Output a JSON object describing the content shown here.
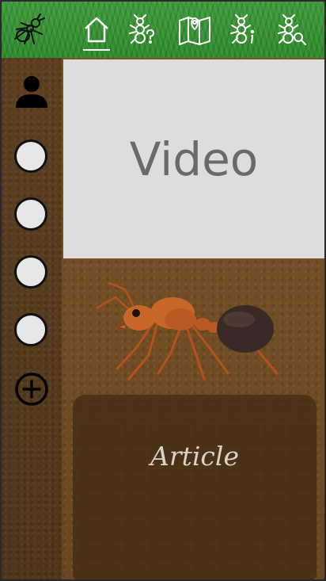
{
  "nav": {
    "items": [
      {
        "icon": "ant-logo-icon"
      },
      {
        "icon": "home-icon",
        "active": true
      },
      {
        "icon": "ant-question-icon"
      },
      {
        "icon": "map-icon"
      },
      {
        "icon": "ant-info-icon"
      },
      {
        "icon": "ant-search-icon"
      }
    ]
  },
  "sidebar": {
    "profile_icon": "person-icon",
    "slots": 4,
    "add_icon": "plus-circle-icon"
  },
  "main": {
    "video_label": "Video",
    "article_label": "Article"
  },
  "colors": {
    "grass": "#3f9a3a",
    "soil": "#6b4a22",
    "video_bg": "#dddddd"
  }
}
